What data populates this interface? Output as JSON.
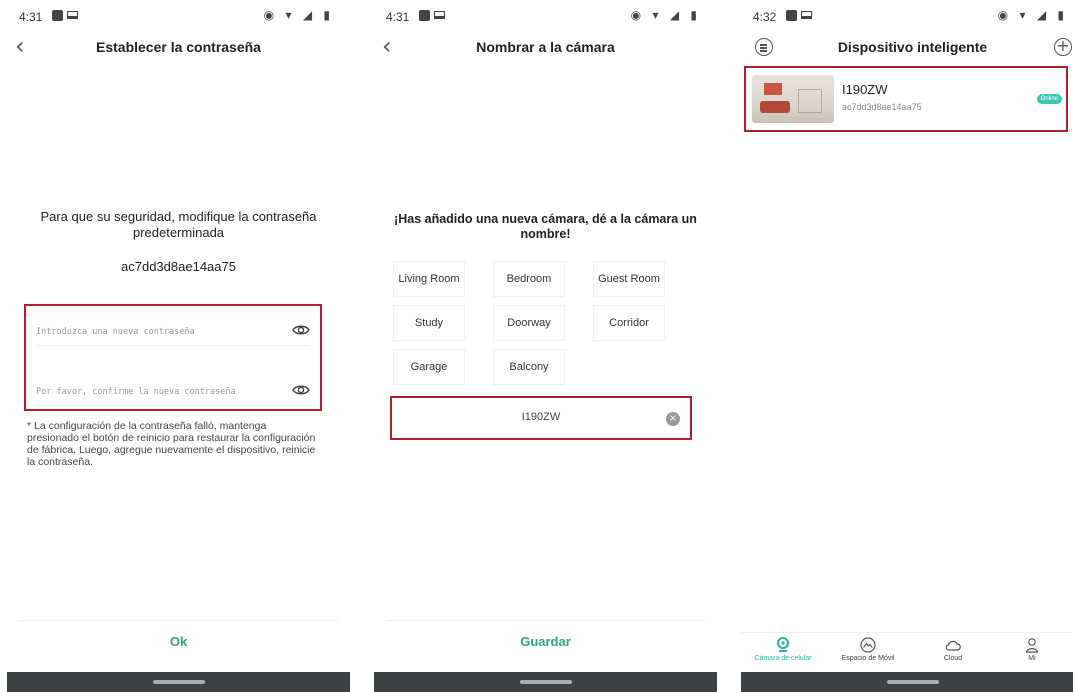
{
  "status_left_1": "4:31",
  "status_left_2": "4:31",
  "status_left_3": "4:32",
  "status_icons": "◉ ▾ ◢ ▮",
  "screen1": {
    "title": "Establecer la contraseña",
    "back": "‹",
    "message": "Para que su seguridad, modifique la contraseña predeterminada",
    "device_id": "ac7dd3d8ae14aa75",
    "new_password_placeholder": "Introduzca una nueva contraseña",
    "confirm_password_placeholder": "Por favor, confirme la nueva contraseña",
    "note": "* La configuración de la contraseña falló, mantenga presionado el botón de reinicio para restaurar la configuración de fábrica. Luego, agregue nuevamente el dispositivo, reinicie la contraseña.",
    "ok_label": "Ok"
  },
  "screen2": {
    "title": "Nombrar a la cámara",
    "back": "‹",
    "message": "¡Has añadido una nueva cámara, dé a la cámara un nombre!",
    "rooms": [
      "Living Room",
      "Bedroom",
      "Guest Room",
      "Study",
      "Doorway",
      "Corridor",
      "Garage",
      "Balcony"
    ],
    "name_value": "I190ZW",
    "clear_icon": "×",
    "save_label": "Guardar"
  },
  "screen3": {
    "title": "Dispositivo inteligente",
    "add_icon": "+",
    "device": {
      "name": "I190ZW",
      "id": "ac7dd3d8ae14aa75",
      "status": "Online"
    },
    "tabs": [
      {
        "label": "Cámara de celular",
        "icon": "camera-icon"
      },
      {
        "label": "Espacio de Móvil",
        "icon": "photo-icon"
      },
      {
        "label": "Cloud",
        "icon": "cloud-icon"
      },
      {
        "label": "Mi",
        "icon": "person-icon"
      }
    ]
  },
  "colors": {
    "accent": "#2fa37b",
    "highlight_border": "#b0222a",
    "online_badge": "#3cc6b3"
  }
}
